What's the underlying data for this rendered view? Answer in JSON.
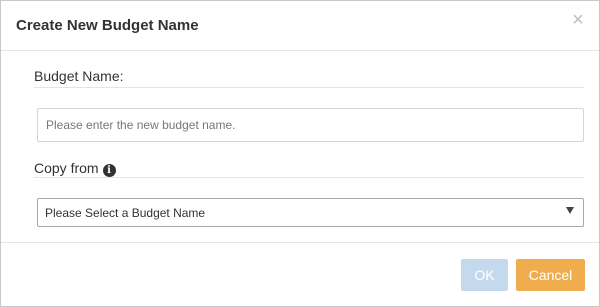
{
  "dialog": {
    "title": "Create New Budget Name",
    "close_symbol": "×"
  },
  "budget_name": {
    "label": "Budget Name:",
    "placeholder": "Please enter the new budget name.",
    "value": ""
  },
  "copy_from": {
    "label": "Copy from",
    "info_icon": "info-icon",
    "selected": "Please Select a Budget Name"
  },
  "footer": {
    "ok_label": "OK",
    "cancel_label": "Cancel"
  },
  "colors": {
    "ok_button": "#c5d9ee",
    "cancel_button": "#f0ad4e"
  }
}
